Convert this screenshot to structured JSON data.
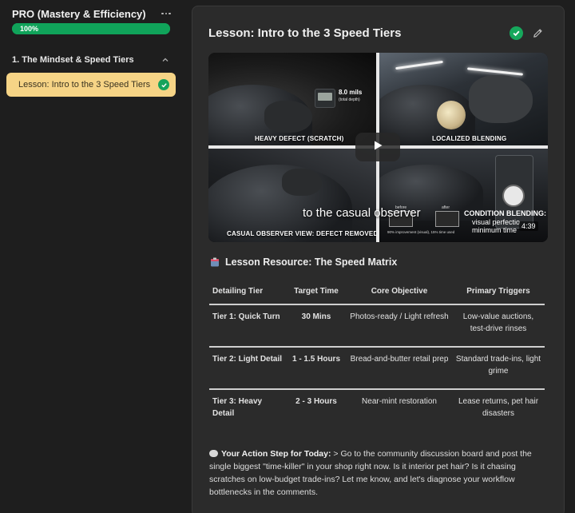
{
  "sidebar": {
    "course_title": "PRO (Mastery & Efficiency)",
    "more_icon": "more-horizontal-icon",
    "progress": {
      "label": "100%",
      "value": 1.0
    },
    "section": {
      "title": "1. The Mindset & Speed Tiers",
      "toggle_icon": "chevron-up-icon"
    },
    "lesson_item": {
      "label": "Lesson: Intro to the 3 Speed Tiers",
      "status_icon": "check-circle-icon"
    }
  },
  "lesson": {
    "title": "Lesson: Intro to the 3 Speed Tiers",
    "complete_icon": "check-circle-icon",
    "edit_icon": "pencil-icon"
  },
  "video": {
    "gauge_reading": "8.0 mils",
    "gauge_sub": "(total depth)",
    "captions": {
      "heavy_defect": "HEAVY DEFECT (SCRATCH)",
      "localized_blending": "LOCALIZED BLENDING",
      "casual_observer": "CASUAL OBSERVER VIEW: DEFECT REMOVED"
    },
    "subtitle": "to the casual observer",
    "before_label": "before",
    "after_label": "after",
    "improvement_note": "90% improvement (visual), 15% time used",
    "condition_title": "CONDITION BLENDING:",
    "condition_sub_1": "visual perfectio",
    "condition_sub_2": "minimum time",
    "duration": "4:39",
    "play_icon": "play-icon"
  },
  "resource": {
    "icon": "clipboard-icon",
    "title": "Lesson Resource: The Speed Matrix",
    "columns": [
      "Detailing Tier",
      "Target Time",
      "Core Objective",
      "Primary Triggers"
    ],
    "rows": [
      [
        "Tier 1: Quick Turn",
        "30 Mins",
        "Photos-ready / Light refresh",
        "Low-value auctions, test-drive rinses"
      ],
      [
        "Tier 2: Light Detail",
        "1 - 1.5 Hours",
        "Bread-and-butter retail prep",
        "Standard trade-ins, light grime"
      ],
      [
        "Tier 3: Heavy Detail",
        "2 - 3 Hours",
        "Near-mint restoration",
        "Lease returns, pet hair disasters"
      ]
    ]
  },
  "action_step": {
    "icon": "speech-bubble-icon",
    "label": "Your Action Step for Today:",
    "text": " > Go to the community discussion board and post the single biggest \"time-killer\" in your shop right now. Is it interior pet hair? Is it chasing scratches on low-budget trade-ins? Let me know, and let's diagnose your workflow bottlenecks in the comments."
  },
  "colors": {
    "accent_green": "#10a35a",
    "active_lesson_bg": "#f6d486",
    "panel_bg": "#2b2b2b",
    "page_bg": "#1e1e1e"
  }
}
